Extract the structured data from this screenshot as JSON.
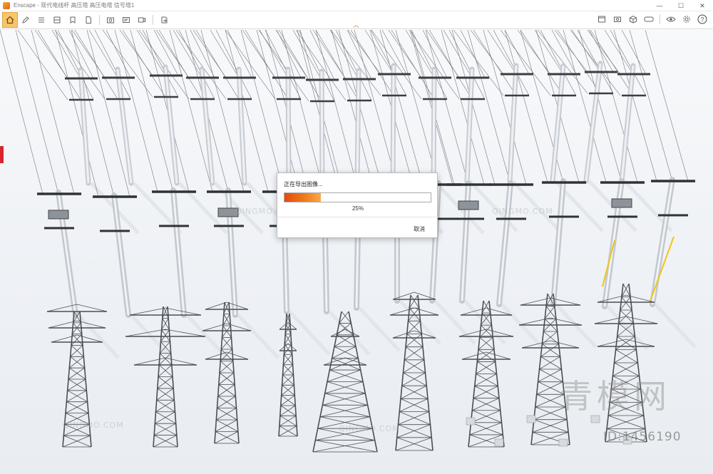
{
  "window": {
    "app_name": "Enscape",
    "title": "Enscape - 现代电线杆 高压塔 高压电塔 信号塔1",
    "minimize_symbol": "—",
    "maximize_symbol": "☐",
    "close_symbol": "✕"
  },
  "toolbar": {
    "left_icons": [
      "home-icon",
      "pencil-icon",
      "list-icon",
      "asset-library-icon",
      "bookmark-icon",
      "file-icon",
      "screenshot-icon",
      "batch-render-icon",
      "video-icon",
      "export-icon"
    ],
    "right_icons": [
      "window-icon",
      "capture-icon",
      "cube-icon",
      "vr-icon",
      "eye-icon",
      "settings-icon",
      "help-icon"
    ],
    "help_label": "?"
  },
  "export_dialog": {
    "title": "正在导出图像...",
    "progress_percent": 25,
    "progress_label": "25%",
    "cancel_label": "取消",
    "accent_color": "#f2801e"
  },
  "watermarks": {
    "brand": "青模网",
    "id_text": "ID:1456190",
    "site": "QINGMO.COM"
  }
}
